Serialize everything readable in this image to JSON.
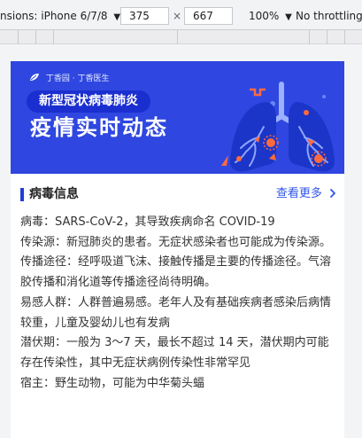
{
  "devtools": {
    "dimensions_label": "nsions: iPhone 6/7/8",
    "dropdown_caret": "▼",
    "width_value": "375",
    "times": "×",
    "height_value": "667",
    "zoom_value": "100%",
    "zoom_caret": "▼",
    "throttling_value": "No throttling"
  },
  "banner": {
    "brand_text": "丁香园 · 丁香医生",
    "tag": "新型冠状病毒肺炎",
    "headline": "疫情实时动态",
    "colors": {
      "background": "#2f47e0",
      "pill": "#1b2ed0",
      "virus": "#ff6a3d"
    }
  },
  "section": {
    "title": "病毒信息",
    "more_label": "查看更多",
    "more_icon": "chevron-right-icon",
    "accent": "#1f3ed8",
    "link_color": "#2f55e8"
  },
  "info": [
    "病毒：SARS-CoV-2，其导致疾病命名 COVID-19",
    "传染源：新冠肺炎的患者。无症状感染者也可能成为传染源。",
    "传播途径：经呼吸道飞沫、接触传播是主要的传播途径。气溶胶传播和消化道等传播途径尚待明确。",
    "易感人群：人群普遍易感。老年人及有基础疾病者感染后病情较重，儿童及婴幼儿也有发病",
    "潜伏期：一般为 3～7 天，最长不超过 14 天，潜伏期内可能存在传染性，其中无症状病例传染性非常罕见",
    "宿主：野生动物，可能为中华菊头蝠"
  ]
}
